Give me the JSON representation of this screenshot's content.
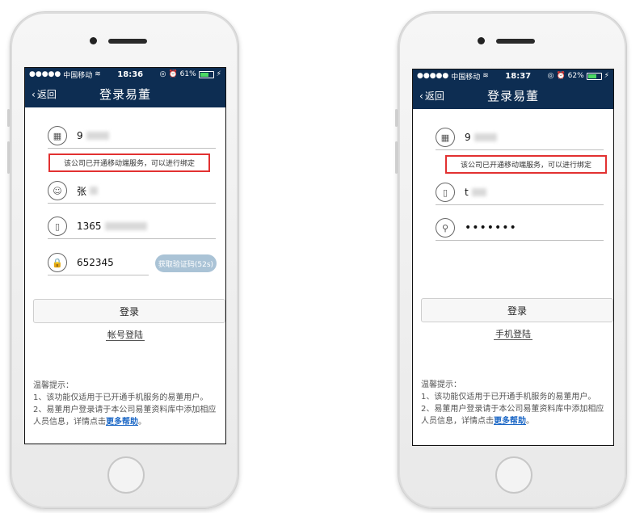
{
  "screens": [
    {
      "status": {
        "carrier": "中国移动",
        "time": "18:36",
        "battery": "61%",
        "battery_level": 0.61
      },
      "nav": {
        "back": "返回",
        "title": "登录易董"
      },
      "fields": [
        {
          "icon": "building-icon",
          "glyph": "▦",
          "value": "9"
        },
        {
          "icon": "user-icon",
          "glyph": "☺",
          "value": "张"
        },
        {
          "icon": "phone-icon",
          "glyph": "▯",
          "value": "1365"
        },
        {
          "icon": "lock-icon",
          "glyph": "🔒",
          "value": "652345"
        }
      ],
      "hint": "该公司已开通移动端服务，可以进行绑定",
      "sms_button": "获取验证码(52s)",
      "login": "登录",
      "switch": "帐号登陆",
      "tips": {
        "title": "温馨提示：",
        "line1": "1、该功能仅适用于已开通手机服务的易董用户。",
        "line2": "2、易董用户登录请于本公司易董资料库中添加相应人员信息，详情点击",
        "link": "更多帮助",
        "end": "。"
      }
    },
    {
      "status": {
        "carrier": "中国移动",
        "time": "18:37",
        "battery": "62%",
        "battery_level": 0.62
      },
      "nav": {
        "back": "返回",
        "title": "登录易董"
      },
      "fields": [
        {
          "icon": "building-icon",
          "glyph": "▦",
          "value": "9"
        },
        {
          "icon": "phone-icon",
          "glyph": "▯",
          "value": "t"
        },
        {
          "icon": "search-icon",
          "glyph": "⚲",
          "value": "•••••••"
        }
      ],
      "hint": "该公司已开通移动端服务，可以进行绑定",
      "login": "登录",
      "switch": "手机登陆",
      "tips": {
        "title": "温馨提示：",
        "line1": "1、该功能仅适用于已开通手机服务的易董用户。",
        "line2": "2、易董用户登录请于本公司易董资料库中添加相应人员信息，详情点击",
        "link": "更多帮助",
        "end": "。"
      }
    }
  ]
}
